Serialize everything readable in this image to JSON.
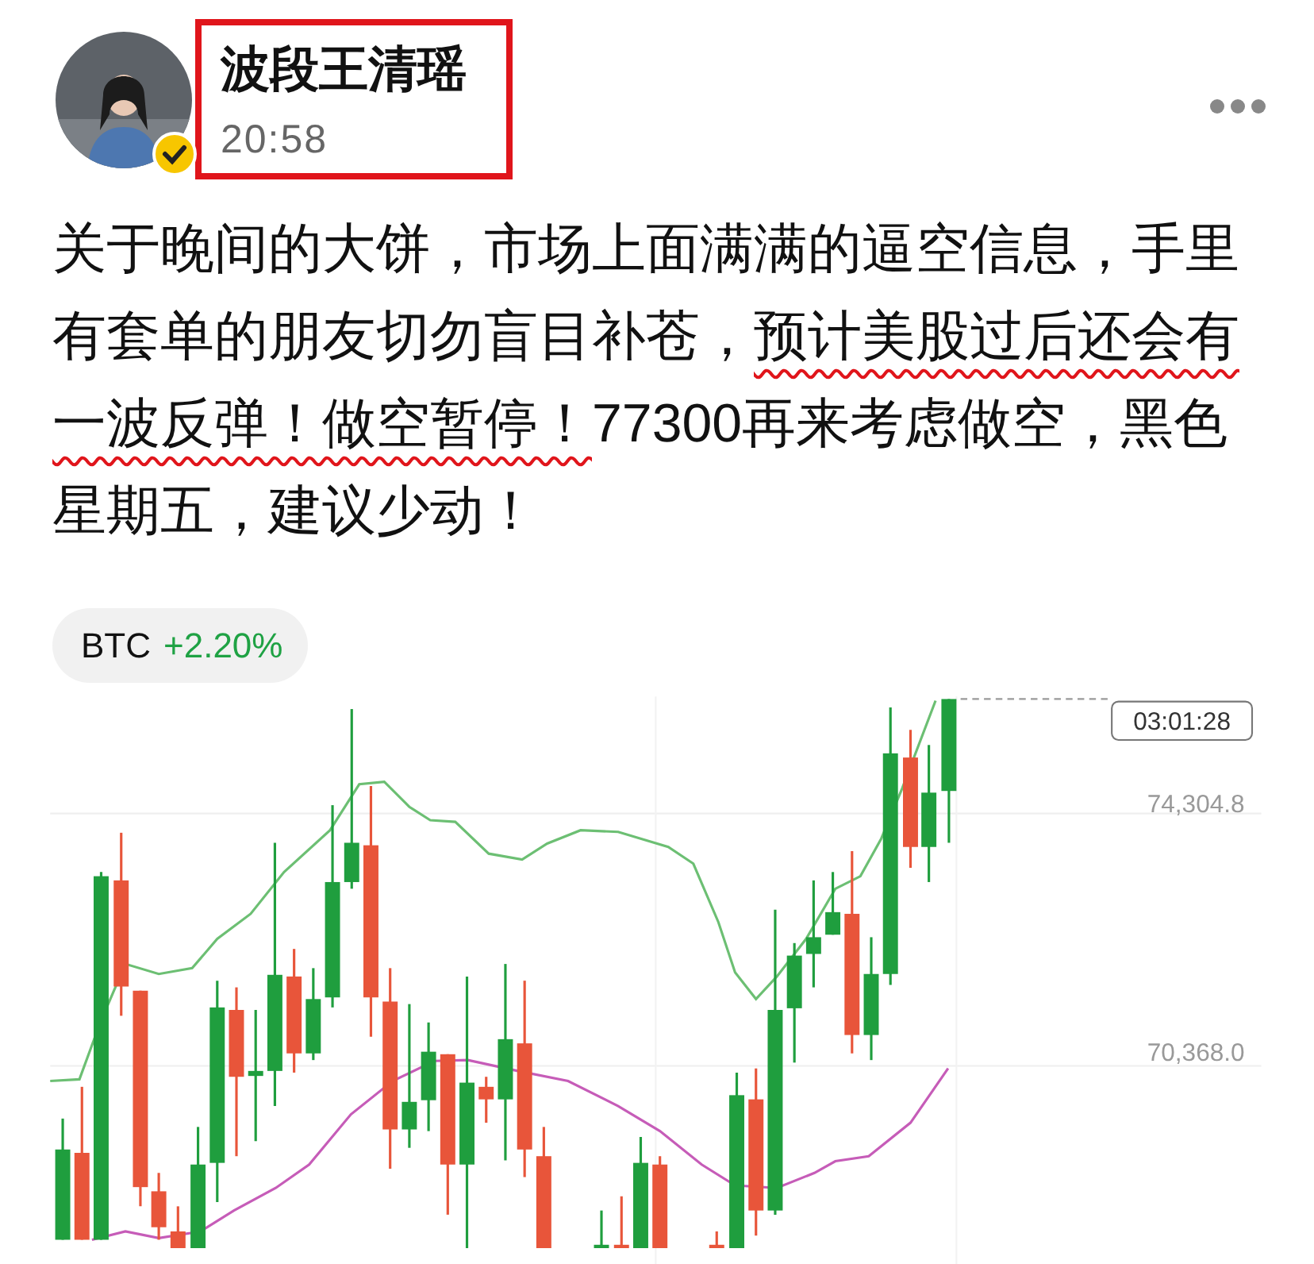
{
  "author": {
    "name": "波段王清瑶",
    "time": "20:58",
    "verified": true,
    "highlighted": true
  },
  "post": {
    "segments": [
      {
        "text": "关于晚间的大饼，市场上面满满的逼空信息，手里有套单的朋友切勿盲目补苍，",
        "underlined": false
      },
      {
        "text": "预计美股过后还会有一波反弹！做空暂停！",
        "underlined": true
      },
      {
        "text": "77300再来考虑做空，黑色星期五，建议少动！",
        "underlined": false
      }
    ]
  },
  "ticker": {
    "symbol": "BTC",
    "change": "+2.20%",
    "rising": true
  },
  "chart": {
    "price_labels": [
      "74,304.8",
      "70,368.0"
    ],
    "countdown": "03:01:28"
  }
}
